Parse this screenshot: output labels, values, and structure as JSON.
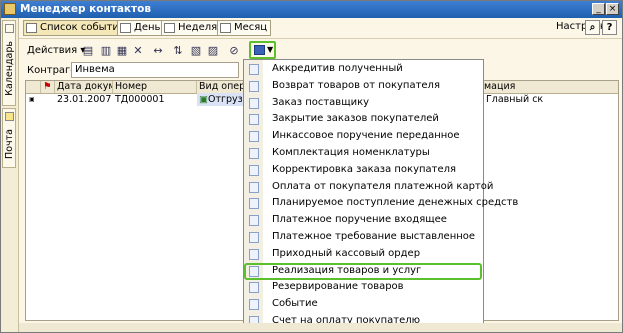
{
  "window": {
    "title": "Менеджер контактов"
  },
  "side_tabs": [
    {
      "label": "Календарь"
    },
    {
      "label": "Почта"
    }
  ],
  "toolbar": {
    "events_list": "Список событий",
    "day": "День",
    "week": "Неделя",
    "month": "Месяц",
    "settings": "Настройка",
    "help": "?"
  },
  "actions": {
    "label": "Действия"
  },
  "filter": {
    "label": "Контрагент:",
    "value": "Инвема"
  },
  "grid": {
    "columns": [
      "Дата докуме...",
      "Номер",
      "Вид операци",
      "",
      "мация"
    ],
    "row": {
      "date": "23.01.2007",
      "number": "ТД000001",
      "operation": "Отгрузк",
      "info": "Главный ск"
    }
  },
  "create_menu": {
    "items": [
      "Аккредитив полученный",
      "Возврат товаров от покупателя",
      "Заказ поставщику",
      "Закрытие заказов покупателей",
      "Инкассовое поручение переданное",
      "Комплектация номенклатуры",
      "Корректировка заказа покупателя",
      "Оплата от покупателя платежной картой",
      "Планируемое поступление денежных средств",
      "Платежное поручение входящее",
      "Платежное требование выставленное",
      "Приходный кассовый ордер",
      "Реализация товаров и услуг",
      "Резервирование товаров",
      "Событие",
      "Счет на оплату покупателю"
    ],
    "highlighted_index": 12
  },
  "colors": {
    "title_bar": "#2a6cc4",
    "highlight": "#5bbf2e"
  }
}
